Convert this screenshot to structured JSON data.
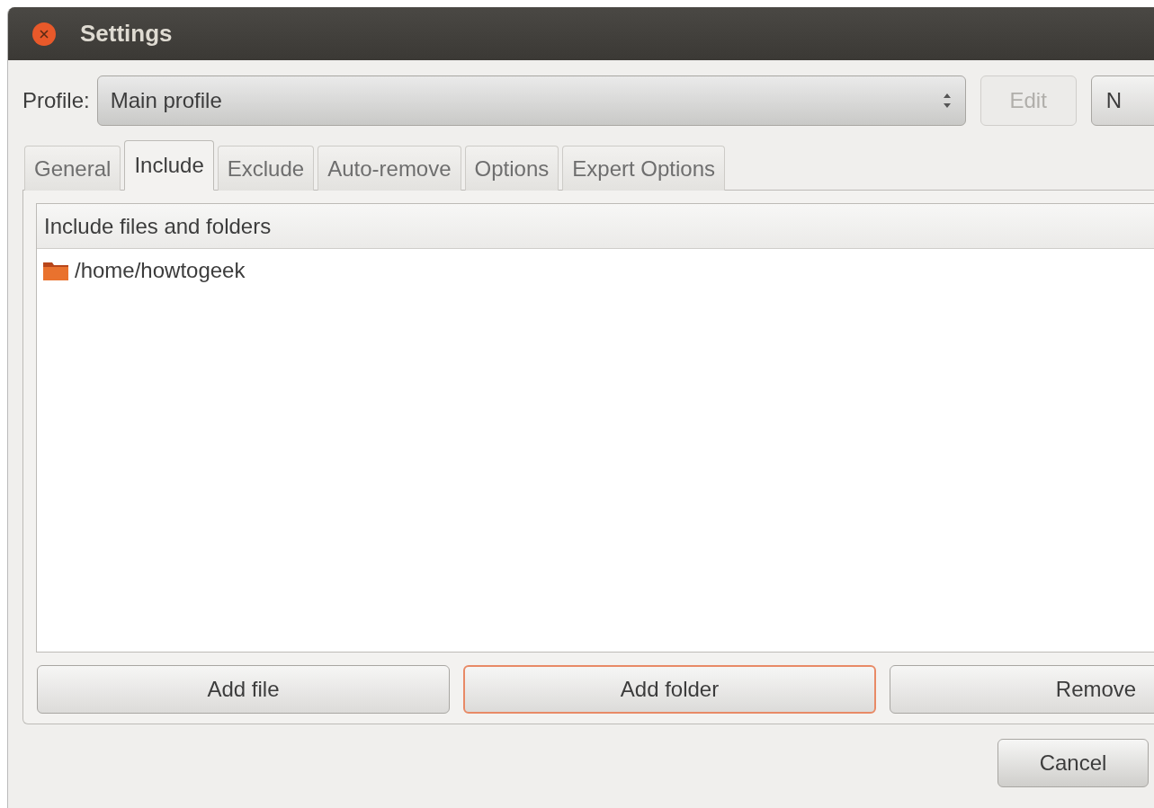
{
  "window": {
    "title": "Settings"
  },
  "profile": {
    "label": "Profile:",
    "value": "Main profile"
  },
  "profile_buttons": [
    {
      "label": "Edit",
      "disabled": true
    },
    {
      "label": "N",
      "disabled": false
    }
  ],
  "tabs": [
    {
      "label": "General",
      "selected": false
    },
    {
      "label": "Include",
      "selected": true
    },
    {
      "label": "Exclude",
      "selected": false
    },
    {
      "label": "Auto-remove",
      "selected": false
    },
    {
      "label": "Options",
      "selected": false
    },
    {
      "label": "Expert Options",
      "selected": false
    }
  ],
  "list": {
    "header": "Include files and folders",
    "items": [
      {
        "path": "/home/howtogeek"
      }
    ]
  },
  "list_buttons": [
    {
      "label": "Add file",
      "focused": false
    },
    {
      "label": "Add folder",
      "focused": true
    },
    {
      "label": "Remove",
      "focused": false
    }
  ],
  "dialog_buttons": [
    {
      "label": "Cancel"
    }
  ]
}
